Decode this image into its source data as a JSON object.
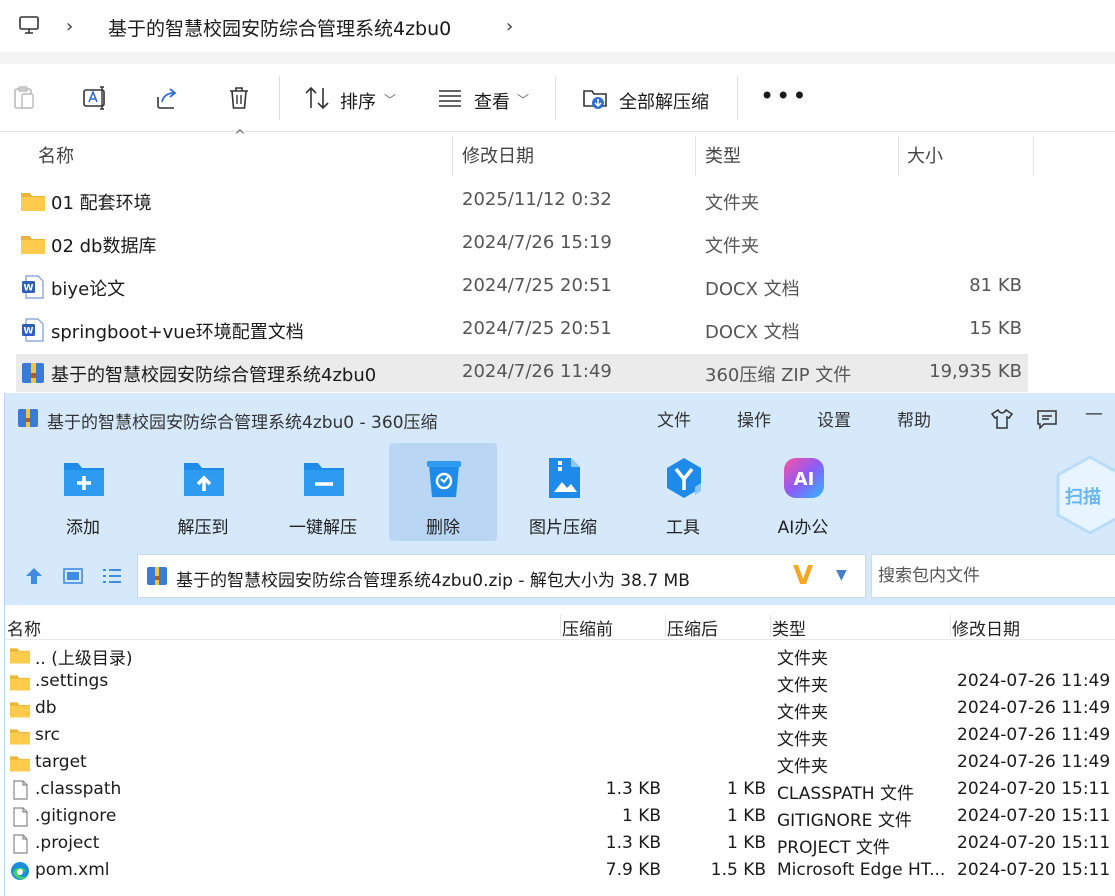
{
  "explorer": {
    "breadcrumb": "基于的智慧校园安防综合管理系统4zbu0",
    "toolbar": {
      "sort_label": "排序",
      "view_label": "查看",
      "extract_all_label": "全部解压缩",
      "more_label": "•••"
    },
    "columns": {
      "name": "名称",
      "modified": "修改日期",
      "type": "类型",
      "size": "大小"
    },
    "files": [
      {
        "name": "01 配套环境",
        "date": "2025/11/12 0:32",
        "type": "文件夹",
        "size": "",
        "icon": "folder-icon"
      },
      {
        "name": "02 db数据库",
        "date": "2024/7/26 15:19",
        "type": "文件夹",
        "size": "",
        "icon": "folder-icon"
      },
      {
        "name": "biye论文",
        "date": "2024/7/25 20:51",
        "type": "DOCX 文档",
        "size": "81 KB",
        "icon": "word-doc-icon"
      },
      {
        "name": "springboot+vue环境配置文档",
        "date": "2024/7/25 20:51",
        "type": "DOCX 文档",
        "size": "15 KB",
        "icon": "word-doc-icon"
      },
      {
        "name": "基于的智慧校园安防综合管理系统4zbu0",
        "date": "2024/7/26 11:49",
        "type": "360压缩 ZIP 文件",
        "size": "19,935 KB",
        "icon": "zip-icon",
        "selected": true
      }
    ]
  },
  "zip_window": {
    "title": "基于的智慧校园安防综合管理系统4zbu0 - 360压缩",
    "menu": [
      "文件",
      "操作",
      "设置",
      "帮助"
    ],
    "tools": [
      {
        "label": "添加",
        "icon": "add-icon"
      },
      {
        "label": "解压到",
        "icon": "extract-to-icon"
      },
      {
        "label": "一键解压",
        "icon": "one-click-extract-icon"
      },
      {
        "label": "删除",
        "icon": "delete-icon"
      },
      {
        "label": "图片压缩",
        "icon": "image-compress-icon"
      },
      {
        "label": "工具",
        "icon": "tools-icon"
      },
      {
        "label": "AI办公",
        "icon": "ai-office-icon"
      }
    ],
    "scan_label": "扫描",
    "path_text": "基于的智慧校园安防综合管理系统4zbu0.zip - 解包大小为 38.7 MB",
    "search_placeholder": "搜索包内文件",
    "columns": {
      "name": "名称",
      "before": "压缩前",
      "after": "压缩后",
      "type": "类型",
      "modified": "修改日期"
    },
    "entries": [
      {
        "name": ".. (上级目录)",
        "before": "",
        "after": "",
        "type": "文件夹",
        "date": "",
        "icon": "folder-icon"
      },
      {
        "name": ".settings",
        "before": "",
        "after": "",
        "type": "文件夹",
        "date": "2024-07-26 11:49",
        "icon": "folder-icon"
      },
      {
        "name": "db",
        "before": "",
        "after": "",
        "type": "文件夹",
        "date": "2024-07-26 11:49",
        "icon": "folder-icon"
      },
      {
        "name": "src",
        "before": "",
        "after": "",
        "type": "文件夹",
        "date": "2024-07-26 11:49",
        "icon": "folder-icon"
      },
      {
        "name": "target",
        "before": "",
        "after": "",
        "type": "文件夹",
        "date": "2024-07-26 11:49",
        "icon": "folder-icon"
      },
      {
        "name": ".classpath",
        "before": "1.3 KB",
        "after": "1 KB",
        "type": "CLASSPATH 文件",
        "date": "2024-07-20 15:11",
        "icon": "file-icon"
      },
      {
        "name": ".gitignore",
        "before": "1 KB",
        "after": "1 KB",
        "type": "GITIGNORE 文件",
        "date": "2024-07-20 15:11",
        "icon": "file-icon"
      },
      {
        "name": ".project",
        "before": "1.3 KB",
        "after": "1 KB",
        "type": "PROJECT 文件",
        "date": "2024-07-20 15:11",
        "icon": "file-icon"
      },
      {
        "name": "pom.xml",
        "before": "7.9 KB",
        "after": "1.5 KB",
        "type": "Microsoft Edge HT...",
        "date": "2024-07-20 15:11",
        "icon": "edge-icon"
      }
    ]
  }
}
